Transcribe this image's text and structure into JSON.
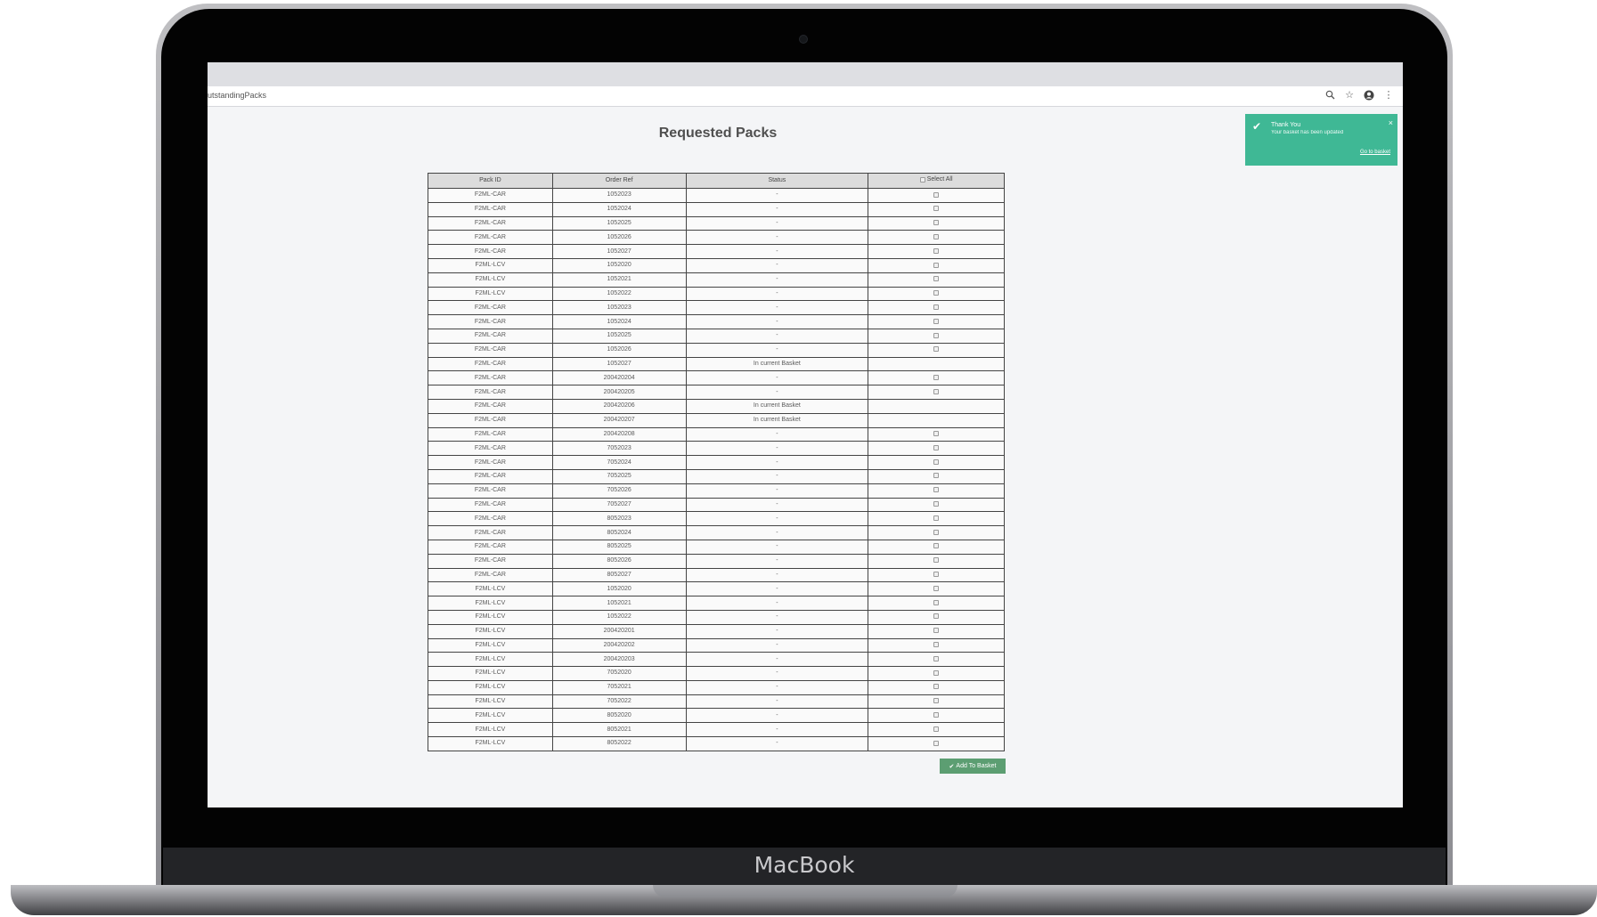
{
  "device": {
    "brand": "MacBook"
  },
  "browser": {
    "url_fragment": "utstandingPacks"
  },
  "page": {
    "title": "Requested Packs"
  },
  "table": {
    "headers": {
      "pack_id": "Pack ID",
      "order_ref": "Order Ref",
      "status": "Status",
      "select_all": "Select All"
    },
    "rows": [
      {
        "pack_id": "F2ML-CAR",
        "order_ref": "1052023",
        "status": "-",
        "selectable": true
      },
      {
        "pack_id": "F2ML-CAR",
        "order_ref": "1052024",
        "status": "-",
        "selectable": true
      },
      {
        "pack_id": "F2ML-CAR",
        "order_ref": "1052025",
        "status": "-",
        "selectable": true
      },
      {
        "pack_id": "F2ML-CAR",
        "order_ref": "1052026",
        "status": "-",
        "selectable": true
      },
      {
        "pack_id": "F2ML-CAR",
        "order_ref": "1052027",
        "status": "-",
        "selectable": true
      },
      {
        "pack_id": "F2ML-LCV",
        "order_ref": "1052020",
        "status": "-",
        "selectable": true
      },
      {
        "pack_id": "F2ML-LCV",
        "order_ref": "1052021",
        "status": "-",
        "selectable": true
      },
      {
        "pack_id": "F2ML-LCV",
        "order_ref": "1052022",
        "status": "-",
        "selectable": true
      },
      {
        "pack_id": "F2ML-CAR",
        "order_ref": "1052023",
        "status": "-",
        "selectable": true
      },
      {
        "pack_id": "F2ML-CAR",
        "order_ref": "1052024",
        "status": "-",
        "selectable": true
      },
      {
        "pack_id": "F2ML-CAR",
        "order_ref": "1052025",
        "status": "-",
        "selectable": true
      },
      {
        "pack_id": "F2ML-CAR",
        "order_ref": "1052026",
        "status": "-",
        "selectable": true
      },
      {
        "pack_id": "F2ML-CAR",
        "order_ref": "1052027",
        "status": "In current Basket",
        "selectable": false
      },
      {
        "pack_id": "F2ML-CAR",
        "order_ref": "200420204",
        "status": "-",
        "selectable": true
      },
      {
        "pack_id": "F2ML-CAR",
        "order_ref": "200420205",
        "status": "-",
        "selectable": true
      },
      {
        "pack_id": "F2ML-CAR",
        "order_ref": "200420206",
        "status": "In current Basket",
        "selectable": false
      },
      {
        "pack_id": "F2ML-CAR",
        "order_ref": "200420207",
        "status": "In current Basket",
        "selectable": false
      },
      {
        "pack_id": "F2ML-CAR",
        "order_ref": "200420208",
        "status": "-",
        "selectable": true
      },
      {
        "pack_id": "F2ML-CAR",
        "order_ref": "7052023",
        "status": "-",
        "selectable": true
      },
      {
        "pack_id": "F2ML-CAR",
        "order_ref": "7052024",
        "status": "-",
        "selectable": true
      },
      {
        "pack_id": "F2ML-CAR",
        "order_ref": "7052025",
        "status": "-",
        "selectable": true
      },
      {
        "pack_id": "F2ML-CAR",
        "order_ref": "7052026",
        "status": "-",
        "selectable": true
      },
      {
        "pack_id": "F2ML-CAR",
        "order_ref": "7052027",
        "status": "-",
        "selectable": true
      },
      {
        "pack_id": "F2ML-CAR",
        "order_ref": "8052023",
        "status": "-",
        "selectable": true
      },
      {
        "pack_id": "F2ML-CAR",
        "order_ref": "8052024",
        "status": "-",
        "selectable": true
      },
      {
        "pack_id": "F2ML-CAR",
        "order_ref": "8052025",
        "status": "-",
        "selectable": true
      },
      {
        "pack_id": "F2ML-CAR",
        "order_ref": "8052026",
        "status": "-",
        "selectable": true
      },
      {
        "pack_id": "F2ML-CAR",
        "order_ref": "8052027",
        "status": "-",
        "selectable": true
      },
      {
        "pack_id": "F2ML-LCV",
        "order_ref": "1052020",
        "status": "-",
        "selectable": true
      },
      {
        "pack_id": "F2ML-LCV",
        "order_ref": "1052021",
        "status": "-",
        "selectable": true
      },
      {
        "pack_id": "F2ML-LCV",
        "order_ref": "1052022",
        "status": "-",
        "selectable": true
      },
      {
        "pack_id": "F2ML-LCV",
        "order_ref": "200420201",
        "status": "-",
        "selectable": true
      },
      {
        "pack_id": "F2ML-LCV",
        "order_ref": "200420202",
        "status": "-",
        "selectable": true
      },
      {
        "pack_id": "F2ML-LCV",
        "order_ref": "200420203",
        "status": "-",
        "selectable": true
      },
      {
        "pack_id": "F2ML-LCV",
        "order_ref": "7052020",
        "status": "-",
        "selectable": true
      },
      {
        "pack_id": "F2ML-LCV",
        "order_ref": "7052021",
        "status": "-",
        "selectable": true
      },
      {
        "pack_id": "F2ML-LCV",
        "order_ref": "7052022",
        "status": "-",
        "selectable": true
      },
      {
        "pack_id": "F2ML-LCV",
        "order_ref": "8052020",
        "status": "-",
        "selectable": true
      },
      {
        "pack_id": "F2ML-LCV",
        "order_ref": "8052021",
        "status": "-",
        "selectable": true
      },
      {
        "pack_id": "F2ML-LCV",
        "order_ref": "8052022",
        "status": "-",
        "selectable": true
      }
    ]
  },
  "actions": {
    "add_to_basket": "Add To Basket"
  },
  "toast": {
    "title": "Thank You",
    "message": "Your basket has been updated",
    "link": "Go to basket",
    "close": "×",
    "color": "#3fb895"
  },
  "colors": {
    "button": "#5c9e72"
  }
}
